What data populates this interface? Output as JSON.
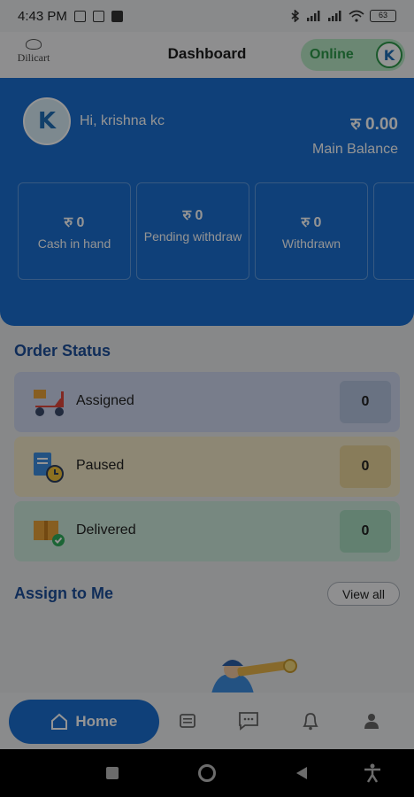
{
  "status_bar": {
    "time": "4:43 PM",
    "battery": "63"
  },
  "header": {
    "logo_text": "Dilicart",
    "title": "Dashboard",
    "online_label": "Online",
    "toggle_initial": "K"
  },
  "balance": {
    "avatar_initial": "K",
    "greeting": "Hi, krishna kc",
    "amount": "रु 0.00",
    "amount_label": "Main Balance",
    "stats": [
      {
        "value": "रु 0",
        "label": "Cash in hand"
      },
      {
        "value": "रु 0",
        "label": "Pending withdraw"
      },
      {
        "value": "रु 0",
        "label": "Withdrawn"
      }
    ]
  },
  "order_status": {
    "title": "Order Status",
    "items": [
      {
        "name": "Assigned",
        "count": "0",
        "icon": "scooter-icon"
      },
      {
        "name": "Paused",
        "count": "0",
        "icon": "clock-document-icon"
      },
      {
        "name": "Delivered",
        "count": "0",
        "icon": "delivered-box-icon"
      }
    ]
  },
  "assign": {
    "title": "Assign to Me",
    "view_all": "View all"
  },
  "bottom_nav": {
    "home_label": "Home",
    "items": [
      "home-icon",
      "orders-icon",
      "chat-icon",
      "bell-icon",
      "profile-icon"
    ]
  },
  "colors": {
    "primary": "#1a6fd0",
    "online": "#2e9a4a",
    "assigned_bg": "#cfd8ef",
    "paused_bg": "#f3e9c9",
    "delivered_bg": "#cdebdc"
  }
}
